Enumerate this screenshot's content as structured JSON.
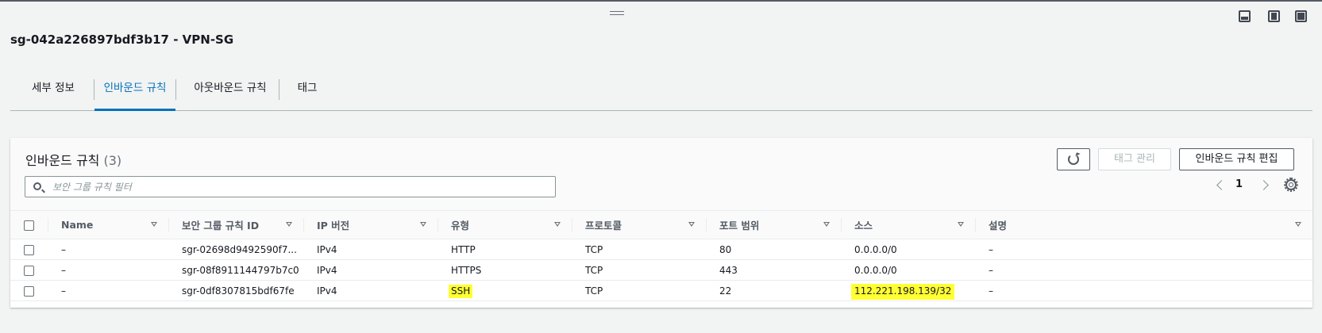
{
  "page": {
    "title": "sg-042a226897bdf3b17 - VPN-SG"
  },
  "tabs": [
    {
      "label": "세부 정보"
    },
    {
      "label": "인바운드 규칙"
    },
    {
      "label": "아웃바운드 규칙"
    },
    {
      "label": "태그"
    }
  ],
  "active_tab": "인바운드 규칙",
  "panel": {
    "title": "인바운드 규칙",
    "count": "(3)",
    "tag_button": "태그 관리",
    "edit_button": "인바운드 규칙 편집",
    "filter_placeholder": "보안 그룹 규칙 필터",
    "page_number": "1"
  },
  "table": {
    "columns": [
      "Name",
      "보안 그룹 규칙 ID",
      "IP 버전",
      "유형",
      "프로토콜",
      "포트 범위",
      "소스",
      "설명"
    ],
    "rows": [
      {
        "name": "–",
        "rule_id": "sgr-02698d9492590f7...",
        "ip_version": "IPv4",
        "type": "HTTP",
        "protocol": "TCP",
        "port_range": "80",
        "source": "0.0.0.0/0",
        "description": "–"
      },
      {
        "name": "–",
        "rule_id": "sgr-08f8911144797b7c0",
        "ip_version": "IPv4",
        "type": "HTTPS",
        "protocol": "TCP",
        "port_range": "443",
        "source": "0.0.0.0/0",
        "description": "–"
      },
      {
        "name": "–",
        "rule_id": "sgr-0df8307815bdf67fe",
        "ip_version": "IPv4",
        "type": "SSH",
        "protocol": "TCP",
        "port_range": "22",
        "source": "112.221.198.139/32",
        "description": "–"
      }
    ]
  },
  "colors": {
    "accent": "#0073bb",
    "highlight": "#ffff33",
    "border": "#aab7b8"
  },
  "icons": [
    "drag-handle-icon",
    "dock-bottom-icon",
    "dock-side-icon",
    "dock-top-icon",
    "refresh-icon",
    "search-icon",
    "chevron-left-icon",
    "chevron-right-icon",
    "gear-icon",
    "sort-icon"
  ]
}
